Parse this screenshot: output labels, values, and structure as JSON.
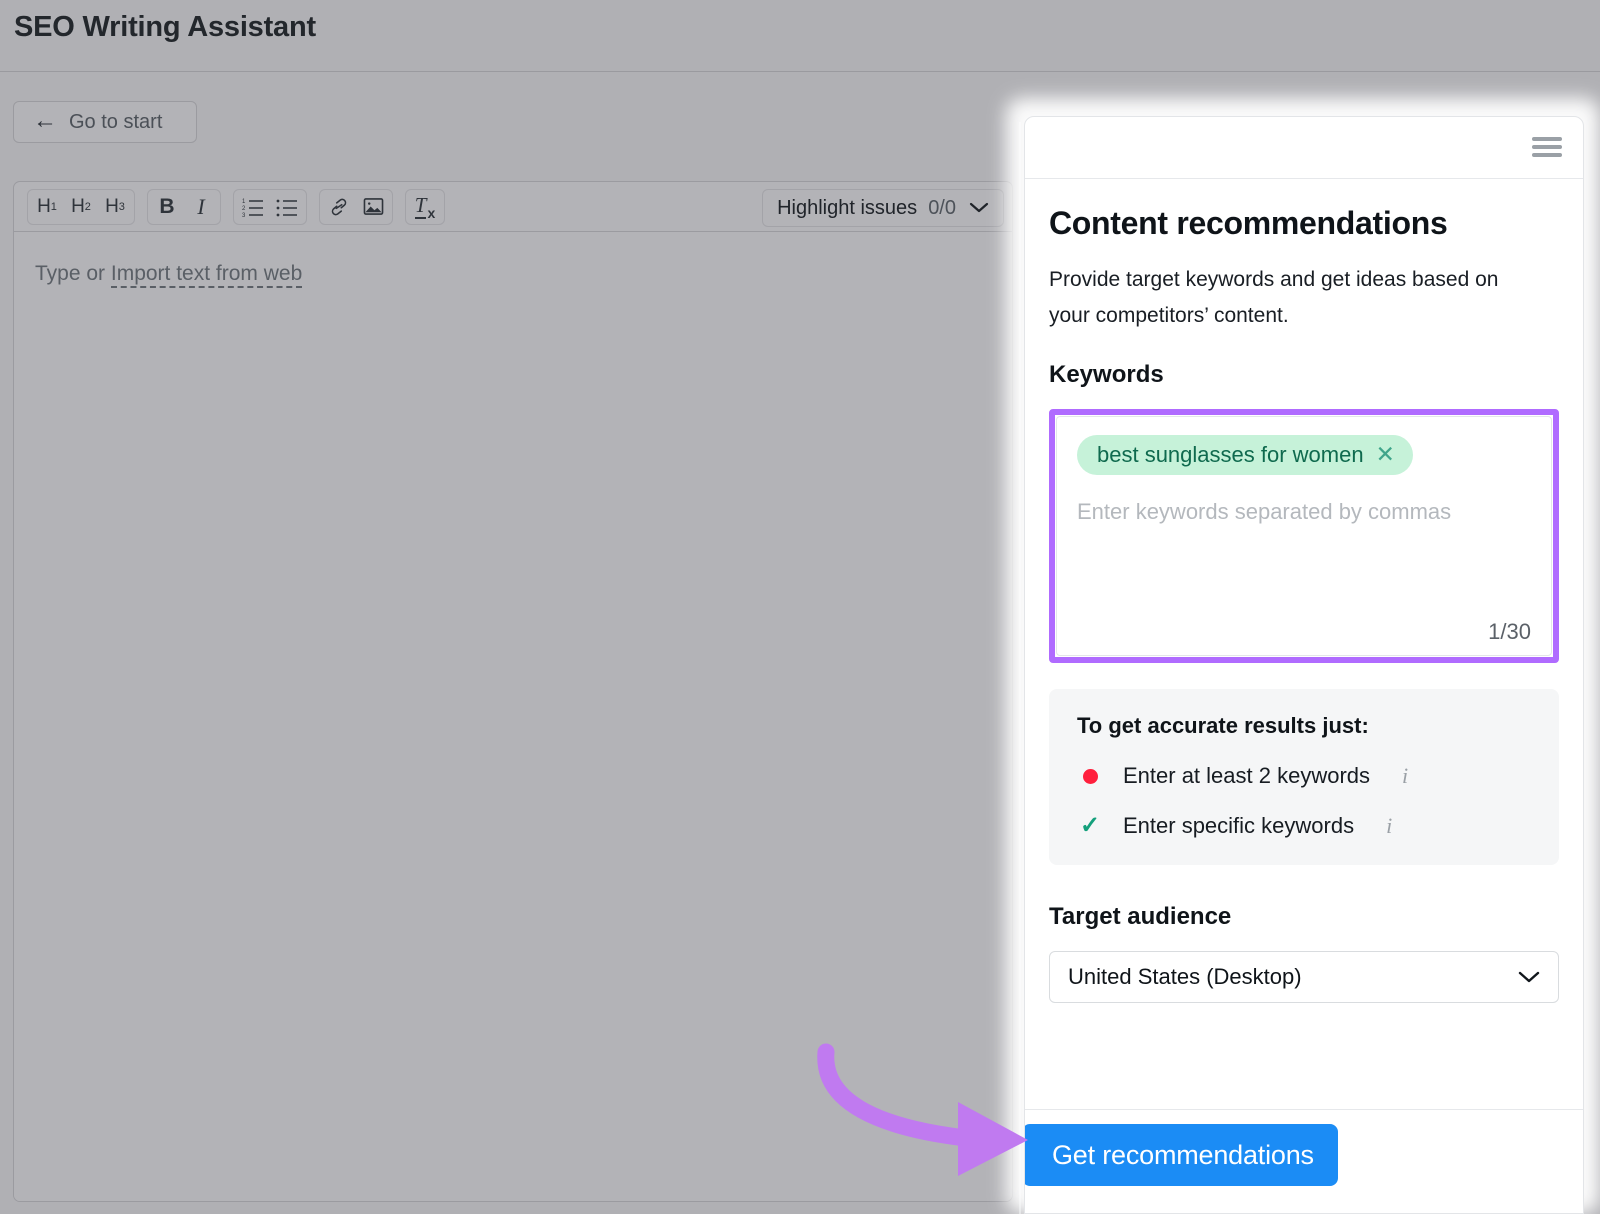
{
  "app": {
    "title": "SEO Writing Assistant",
    "go_to_start_label": "Go to start",
    "back_arrow_icon": "arrow-left-icon"
  },
  "editor": {
    "toolbar": {
      "groups": [
        {
          "name": "headings",
          "buttons": [
            {
              "name": "heading-1",
              "label": "H",
              "sub": "1"
            },
            {
              "name": "heading-2",
              "label": "H",
              "sub": "2"
            },
            {
              "name": "heading-3",
              "label": "H",
              "sub": "3"
            }
          ]
        },
        {
          "name": "text-style",
          "buttons": [
            {
              "name": "bold",
              "label": "B"
            },
            {
              "name": "italic",
              "label": "I"
            }
          ]
        },
        {
          "name": "lists",
          "buttons": [
            {
              "name": "ordered-list",
              "label": ""
            },
            {
              "name": "bulleted-list",
              "label": ""
            }
          ]
        },
        {
          "name": "insert",
          "buttons": [
            {
              "name": "link",
              "label": ""
            },
            {
              "name": "image",
              "label": ""
            }
          ]
        },
        {
          "name": "clear",
          "buttons": [
            {
              "name": "clear-formatting",
              "label": "T",
              "sub": "x"
            }
          ]
        }
      ]
    },
    "highlight_issues": {
      "label": "Highlight issues",
      "count": "0/0",
      "chevron": "chevron-down-icon"
    },
    "placeholder_prefix": "Type or ",
    "placeholder_link": "Import text from web"
  },
  "panel": {
    "menu_icon": "hamburger-menu-icon",
    "title": "Content recommendations",
    "description": "Provide target keywords and get ideas based on your competitors’ content.",
    "keywords": {
      "heading": "Keywords",
      "pills": [
        {
          "text": "best sunglasses for women",
          "remove_icon": "close-icon"
        }
      ],
      "placeholder": "Enter keywords separated by commas",
      "counter": "1/30"
    },
    "tips": {
      "title": "To get accurate results just:",
      "items": [
        {
          "status": "error",
          "marker_icon": "red-dot-icon",
          "text": "Enter at least 2 keywords",
          "info_icon": "info-icon"
        },
        {
          "status": "ok",
          "marker_icon": "check-icon",
          "text": "Enter specific keywords",
          "info_icon": "info-icon"
        }
      ]
    },
    "target_audience": {
      "heading": "Target audience",
      "selected": "United States (Desktop)",
      "chevron": "chevron-down-icon"
    },
    "cta": {
      "label": "Get recommendations"
    }
  },
  "annotation": {
    "arrow_icon": "curved-arrow-icon",
    "arrow_color": "#c07af0",
    "highlight_color": "#b06bff"
  },
  "colors": {
    "accent_blue": "#1b8cf5",
    "pill_bg": "#c6f2d9",
    "pill_text": "#0f6a4e",
    "error_red": "#ff1f3d",
    "success_green": "#14a07c",
    "dim_overlay": "#b0b0b4"
  }
}
